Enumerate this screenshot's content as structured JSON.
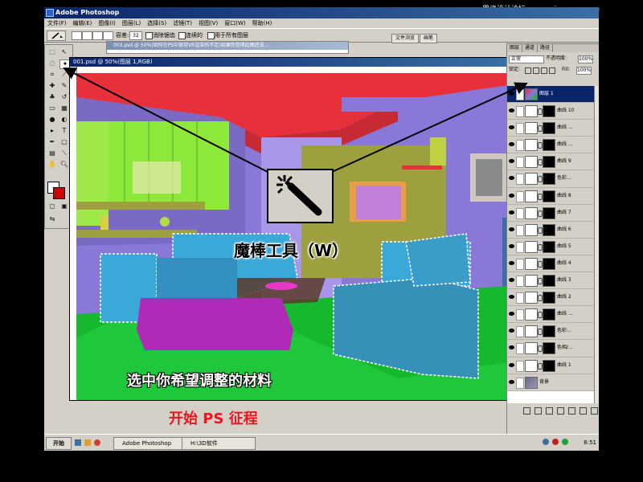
{
  "app": {
    "title": "Adobe Photoshop",
    "menu": [
      "文件(F)",
      "编辑(E)",
      "图像(I)",
      "图层(L)",
      "选择(S)",
      "滤镜(T)",
      "视图(V)",
      "窗口(W)",
      "帮助(H)"
    ]
  },
  "watermark": "思缘设计论坛 www.missyuan.com",
  "options": {
    "tolerance_label": "容差:",
    "tolerance_value": "32",
    "antialias_label": "消除锯齿",
    "contiguous_label": "连续的",
    "all_layers_label": "用于所有图层",
    "tab_browser": "文件浏览",
    "tab_brush": "画笔"
  },
  "bg_window": {
    "title": "003.psd @ 50%(如何在PS中保持VR渲染的不足)如果你觉得此图还没..."
  },
  "document": {
    "title": "001.psd @ 50%(图层 1,RGB)"
  },
  "layers_panel": {
    "tabs": [
      "图层",
      "通道",
      "路径"
    ],
    "blend_mode": "正常",
    "opacity_label": "不透明度:",
    "opacity_value": "100%",
    "lock_label": "锁定:",
    "fill_label": "Fill:",
    "fill_value": "100%",
    "layers": [
      {
        "name": "图层 1",
        "active": true
      },
      {
        "name": "曲线 10"
      },
      {
        "name": "曲线 ..."
      },
      {
        "name": "曲线 ..."
      },
      {
        "name": "曲线 9"
      },
      {
        "name": "色彩..."
      },
      {
        "name": "曲线 8"
      },
      {
        "name": "曲线 7"
      },
      {
        "name": "曲线 6"
      },
      {
        "name": "曲线 5"
      },
      {
        "name": "曲线 4"
      },
      {
        "name": "曲线 3"
      },
      {
        "name": "曲线 2"
      },
      {
        "name": "曲线 ..."
      },
      {
        "name": "色彩..."
      },
      {
        "name": "色相/..."
      },
      {
        "name": "曲线 1"
      },
      {
        "name": "背景"
      }
    ]
  },
  "taskbar": {
    "start": "开始",
    "photoshop": "Adobe Photoshop",
    "folder": "H:\\3D软件",
    "clock": "8:51"
  },
  "annotations": {
    "wand_tool": "魔棒工具（W）",
    "select_material": "选中你希望调整的材料",
    "start_ps": "开始 PS 征程"
  },
  "colors": {
    "ceiling": "#e8303a",
    "wall": "#8a78d8",
    "floor": "#16b82e",
    "sofa": "#3aa9d8",
    "ottoman": "#b02ab8",
    "window": "#8ee83a",
    "cabinet": "#9ea040",
    "start_text": "#e8161f"
  }
}
